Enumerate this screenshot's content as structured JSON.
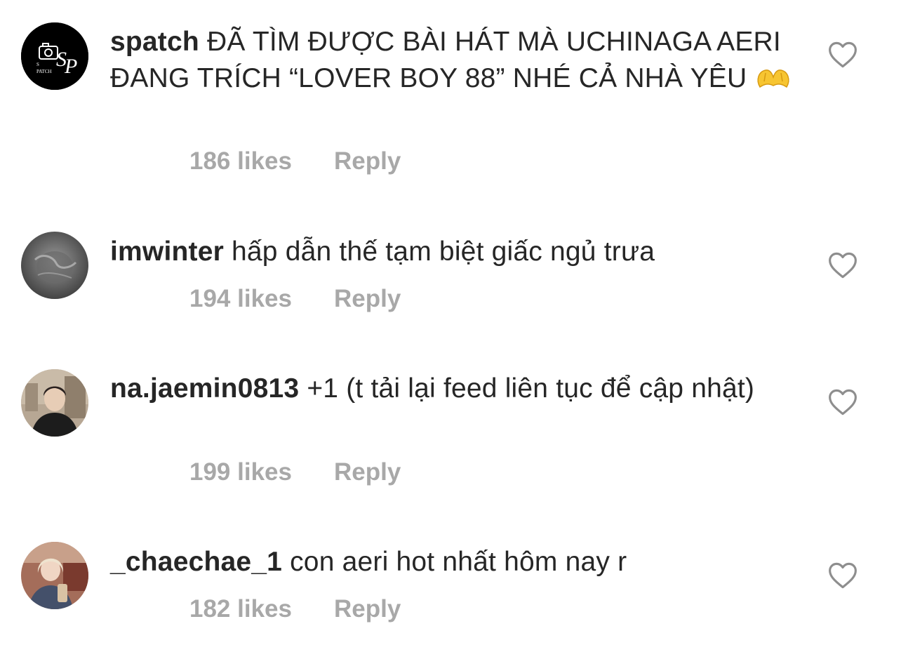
{
  "comments": [
    {
      "username": "spatch",
      "text": "ĐÃ TÌM ĐƯỢC BÀI HÁT MÀ UCHINAGA AERI ĐANG TRÍCH “LOVER BOY 88” NHÉ CẢ NHÀ YÊU",
      "emoji": "heart-hands-emoji",
      "likes": "186 likes",
      "reply": "Reply",
      "avatar": {
        "type": "logo",
        "logo_text": "SP",
        "logo_sub": "S PATCH",
        "bg": "#000000"
      }
    },
    {
      "username": "imwinter",
      "text": "hấp dẫn thế tạm biệt giấc ngủ trưa",
      "likes": "194 likes",
      "reply": "Reply",
      "avatar": {
        "type": "photo",
        "bg": "#4a4a4a"
      }
    },
    {
      "username": "na.jaemin0813",
      "text": "+1 (t tải lại feed liên tục để cập nhật)",
      "likes": "199 likes",
      "reply": "Reply",
      "avatar": {
        "type": "photo",
        "bg": "#8a7a68"
      }
    },
    {
      "username": "_chaechae_1",
      "text": "con aeri hot nhất hôm nay r",
      "likes": "182 likes",
      "reply": "Reply",
      "avatar": {
        "type": "photo",
        "bg": "#b58d7a"
      }
    }
  ],
  "colors": {
    "text": "#262626",
    "meta": "#a8a8a8",
    "heart_outline": "#8e8e8e"
  },
  "icons": {
    "like": "heart-outline-icon"
  }
}
